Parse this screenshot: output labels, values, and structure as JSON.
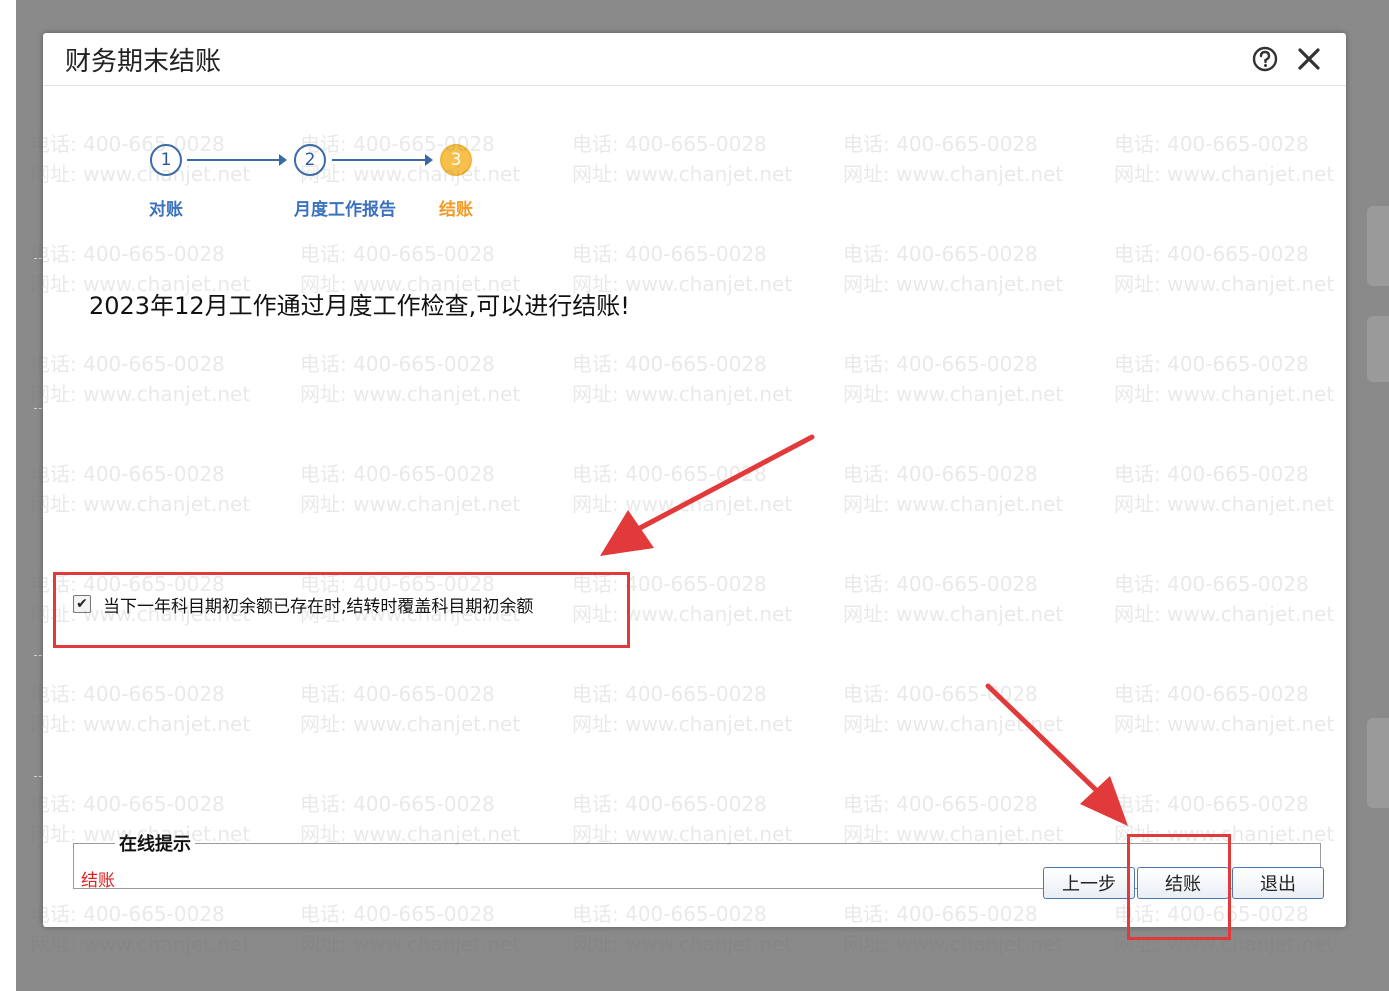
{
  "dialog": {
    "title": "财务期末结账",
    "help_icon": "help-circle-icon",
    "close_icon": "close-icon"
  },
  "steps": [
    {
      "number": "1",
      "label": "对账",
      "state": "done"
    },
    {
      "number": "2",
      "label": "月度工作报告",
      "state": "done"
    },
    {
      "number": "3",
      "label": "结账",
      "state": "active"
    }
  ],
  "message": "2023年12月工作通过月度工作检查,可以进行结账!",
  "option": {
    "checked": true,
    "label": "当下一年科目期初余额已存在时,结转时覆盖科目期初余额"
  },
  "hint": {
    "legend": "在线提示",
    "text": "结账"
  },
  "buttons": {
    "prev": "上一步",
    "close_period": "结账",
    "exit": "退出"
  },
  "watermark": {
    "phone": "电话: 400-665-0028",
    "site": "网址: www.chanjet.net"
  },
  "colors": {
    "step_blue": "#3b6aa9",
    "step_active": "#f6c04b",
    "hint_text": "#e02020",
    "annotation": "#e23a3a"
  }
}
